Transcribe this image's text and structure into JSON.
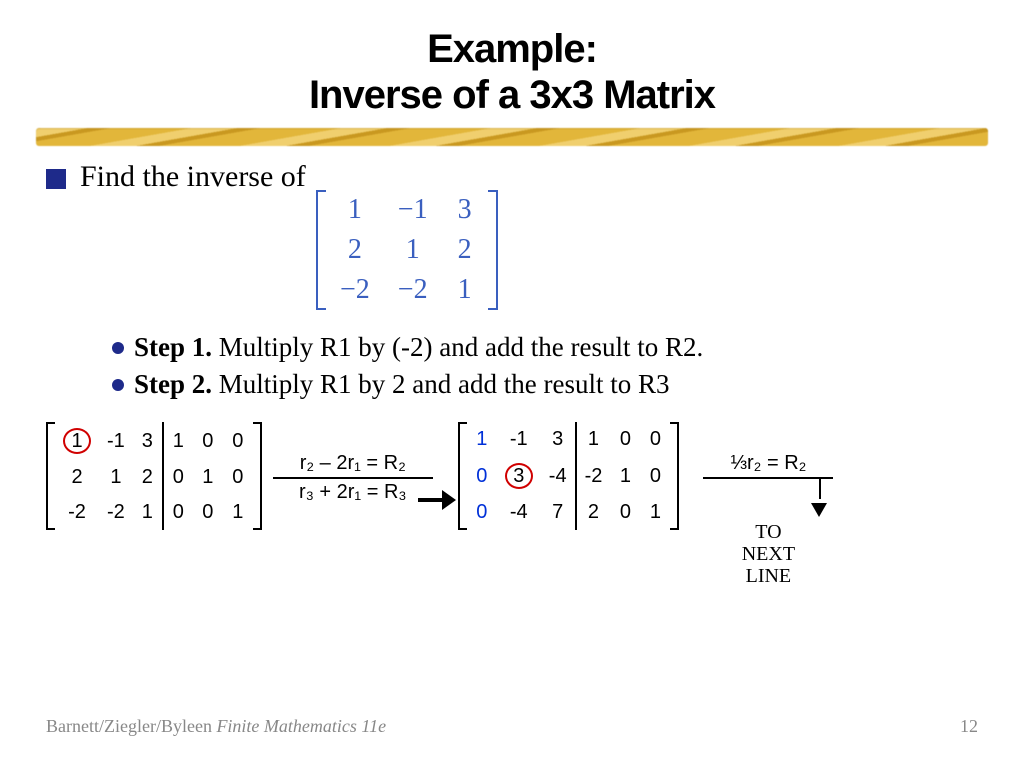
{
  "title_line1": "Example:",
  "title_line2": "Inverse of a 3x3 Matrix",
  "lead": "Find the inverse of",
  "matrix": [
    [
      "1",
      "−1",
      "3"
    ],
    [
      "2",
      "1",
      "2"
    ],
    [
      "−2",
      "−2",
      "1"
    ]
  ],
  "steps": [
    {
      "label": "Step 1.",
      "text": "Multiply R1 by (-2) and add the result to R2."
    },
    {
      "label": "Step 2.",
      "text": "Multiply R1 by 2 and add the result to R3"
    }
  ],
  "aug_before_left": [
    [
      "1",
      "-1",
      "3"
    ],
    [
      "2",
      "1",
      "2"
    ],
    [
      "-2",
      "-2",
      "1"
    ]
  ],
  "aug_before_right": [
    [
      "1",
      "0",
      "0"
    ],
    [
      "0",
      "1",
      "0"
    ],
    [
      "0",
      "0",
      "1"
    ]
  ],
  "circled_before": [
    0,
    0
  ],
  "row_ops": {
    "top": "r₂ – 2r₁ = R₂",
    "bottom": "r₃ + 2r₁ = R₃"
  },
  "aug_after_left": [
    [
      "1",
      "-1",
      "3"
    ],
    [
      "0",
      "3",
      "-4"
    ],
    [
      "0",
      "-4",
      "7"
    ]
  ],
  "aug_after_right": [
    [
      "1",
      "0",
      "0"
    ],
    [
      "-2",
      "1",
      "0"
    ],
    [
      "2",
      "0",
      "1"
    ]
  ],
  "circled_after": [
    1,
    1
  ],
  "side_op": "⅓r₂ = R₂",
  "to_next": [
    "TO",
    "NEXT",
    "LINE"
  ],
  "footer_source_authors": "Barnett/Ziegler/Byleen ",
  "footer_source_title": "Finite Mathematics 11e",
  "page_number": "12"
}
